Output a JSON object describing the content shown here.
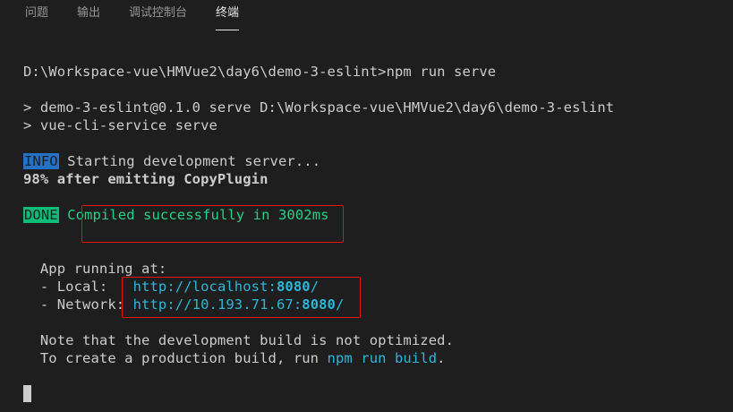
{
  "tabs": [
    {
      "label": "问题"
    },
    {
      "label": "输出"
    },
    {
      "label": "调试控制台"
    },
    {
      "label": "终端",
      "active": true
    }
  ],
  "terminal": {
    "prompt_line": "D:\\Workspace-vue\\HMVue2\\day6\\demo-3-eslint>npm run serve",
    "script_line1": "> demo-3-eslint@0.1.0 serve D:\\Workspace-vue\\HMVue2\\day6\\demo-3-eslint",
    "script_line2": "> vue-cli-service serve",
    "info_badge": "INFO",
    "info_text": " Starting development server...",
    "progress_line": "98% after emitting CopyPlugin",
    "done_badge": "DONE",
    "done_text": " Compiled successfully in 3002ms",
    "app_running": "  App running at:",
    "local_label": "  - Local:   ",
    "local_url_prefix": "http://localhost:",
    "local_url_port": "8080",
    "local_url_suffix": "/",
    "network_label": "  - Network: ",
    "network_url_prefix": "http://10.193.71.67:",
    "network_url_port": "8080",
    "network_url_suffix": "/",
    "note_line": "  Note that the development build is not optimized.",
    "create_prefix": "  To create a production build, run ",
    "create_cmd": "npm run build",
    "create_suffix": "."
  },
  "colors": {
    "background": "#1e1e1e",
    "text": "#cccccc",
    "info_badge": "#2472c8",
    "done_badge": "#0dbc79",
    "success_text": "#23d18b",
    "link": "#29b8db",
    "highlight_box": "#e51400"
  }
}
